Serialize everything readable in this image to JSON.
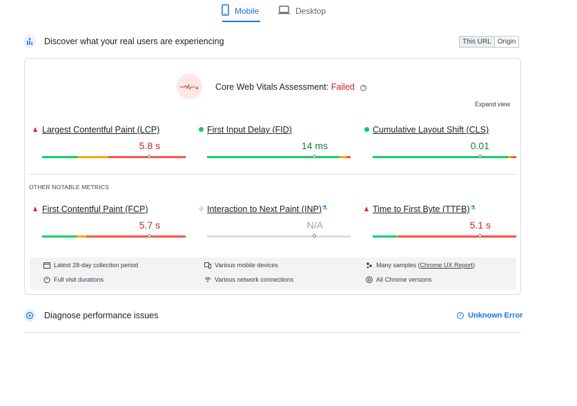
{
  "tabs": [
    {
      "label": "Mobile",
      "icon": "phone-icon",
      "active": true
    },
    {
      "label": "Desktop",
      "icon": "laptop-icon",
      "active": false
    }
  ],
  "field": {
    "title": "Discover what your real users are experiencing",
    "toggle": [
      "This URL",
      "Origin"
    ],
    "assessment": {
      "label": "Core Web Vitals Assessment:",
      "status": "Failed"
    },
    "expand_view": "Expand view",
    "core_metrics": [
      {
        "label": "Largest Contentful Paint (LCP)",
        "value": "5.8 s",
        "status": "poor",
        "distribution": [
          0.25,
          0.21,
          0.54
        ],
        "marker": 0.75
      },
      {
        "label": "First Input Delay (FID)",
        "value": "14 ms",
        "status": "good",
        "distribution": [
          0.92,
          0.05,
          0.03
        ],
        "marker": 0.75
      },
      {
        "label": "Cumulative Layout Shift (CLS)",
        "value": "0.01",
        "status": "good",
        "distribution": [
          0.94,
          0.025,
          0.035
        ],
        "marker": 0.75
      }
    ],
    "other_heading": "OTHER NOTABLE METRICS",
    "other_metrics": [
      {
        "label": "First Contentful Paint (FCP)",
        "value": "5.7 s",
        "status": "poor",
        "distribution": [
          0.24,
          0.07,
          0.69
        ],
        "marker": 0.75
      },
      {
        "label": "Interaction to Next Paint (INP)",
        "value": "N/A",
        "status": "na",
        "experimental": true,
        "marker": 0.75
      },
      {
        "label": "Time to First Byte (TTFB)",
        "value": "5.1 s",
        "status": "poor",
        "experimental": true,
        "distribution": [
          0.17,
          0.01,
          0.82
        ],
        "marker": 0.75
      }
    ],
    "info": {
      "period": "Latest 28-day collection period",
      "durations": "Full visit durations",
      "devices": "Various mobile devices",
      "network": "Various network connections",
      "samples_prefix": "Many samples (",
      "samples_link": "Chrome UX Report",
      "samples_suffix": ")",
      "versions": "All Chrome versions"
    }
  },
  "diagnose": {
    "title": "Diagnose performance issues",
    "error": "Unknown Error"
  },
  "colors": {
    "good": "#0cce6b",
    "avg": "#ffa400",
    "poor": "#ff4e42",
    "na": "#dadce0",
    "good_text": "#188038",
    "poor_text": "#c5221f",
    "na_text": "#9aa0a6",
    "accent": "#1a73e8"
  }
}
